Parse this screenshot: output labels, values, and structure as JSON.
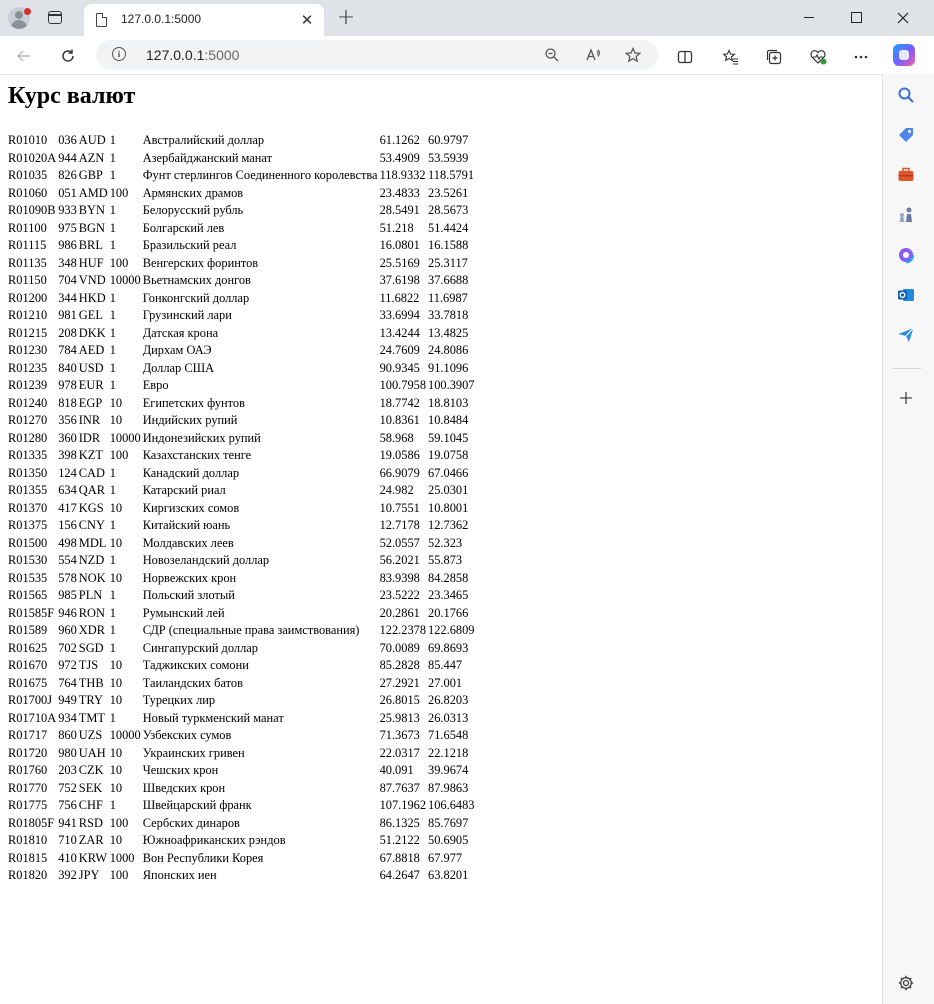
{
  "browser": {
    "tab_title": "127.0.0.1:5000",
    "url_host": "127.0.0.1",
    "url_port": ":5000",
    "new_tab_glyph": "+",
    "close_glyph": "✕"
  },
  "page": {
    "heading": "Курс валют"
  },
  "rates": [
    [
      "R01010",
      "036",
      "AUD",
      "1",
      "Австралийский доллар",
      "61.1262",
      "60.9797"
    ],
    [
      "R01020A",
      "944",
      "AZN",
      "1",
      "Азербайджанский манат",
      "53.4909",
      "53.5939"
    ],
    [
      "R01035",
      "826",
      "GBP",
      "1",
      "Фунт стерлингов Соединенного королевства",
      "118.9332",
      "118.5791"
    ],
    [
      "R01060",
      "051",
      "AMD",
      "100",
      "Армянских драмов",
      "23.4833",
      "23.5261"
    ],
    [
      "R01090B",
      "933",
      "BYN",
      "1",
      "Белорусский рубль",
      "28.5491",
      "28.5673"
    ],
    [
      "R01100",
      "975",
      "BGN",
      "1",
      "Болгарский лев",
      "51.218",
      "51.4424"
    ],
    [
      "R01115",
      "986",
      "BRL",
      "1",
      "Бразильский реал",
      "16.0801",
      "16.1588"
    ],
    [
      "R01135",
      "348",
      "HUF",
      "100",
      "Венгерских форинтов",
      "25.5169",
      "25.3117"
    ],
    [
      "R01150",
      "704",
      "VND",
      "10000",
      "Вьетнамских донгов",
      "37.6198",
      "37.6688"
    ],
    [
      "R01200",
      "344",
      "HKD",
      "1",
      "Гонконгский доллар",
      "11.6822",
      "11.6987"
    ],
    [
      "R01210",
      "981",
      "GEL",
      "1",
      "Грузинский лари",
      "33.6994",
      "33.7818"
    ],
    [
      "R01215",
      "208",
      "DKK",
      "1",
      "Датская крона",
      "13.4244",
      "13.4825"
    ],
    [
      "R01230",
      "784",
      "AED",
      "1",
      "Дирхам ОАЭ",
      "24.7609",
      "24.8086"
    ],
    [
      "R01235",
      "840",
      "USD",
      "1",
      "Доллар США",
      "90.9345",
      "91.1096"
    ],
    [
      "R01239",
      "978",
      "EUR",
      "1",
      "Евро",
      "100.7958",
      "100.3907"
    ],
    [
      "R01240",
      "818",
      "EGP",
      "10",
      "Египетских фунтов",
      "18.7742",
      "18.8103"
    ],
    [
      "R01270",
      "356",
      "INR",
      "10",
      "Индийских рупий",
      "10.8361",
      "10.8484"
    ],
    [
      "R01280",
      "360",
      "IDR",
      "10000",
      "Индонезийских рупий",
      "58.968",
      "59.1045"
    ],
    [
      "R01335",
      "398",
      "KZT",
      "100",
      "Казахстанских тенге",
      "19.0586",
      "19.0758"
    ],
    [
      "R01350",
      "124",
      "CAD",
      "1",
      "Канадский доллар",
      "66.9079",
      "67.0466"
    ],
    [
      "R01355",
      "634",
      "QAR",
      "1",
      "Катарский риал",
      "24.982",
      "25.0301"
    ],
    [
      "R01370",
      "417",
      "KGS",
      "10",
      "Киргизских сомов",
      "10.7551",
      "10.8001"
    ],
    [
      "R01375",
      "156",
      "CNY",
      "1",
      "Китайский юань",
      "12.7178",
      "12.7362"
    ],
    [
      "R01500",
      "498",
      "MDL",
      "10",
      "Молдавских леев",
      "52.0557",
      "52.323"
    ],
    [
      "R01530",
      "554",
      "NZD",
      "1",
      "Новозеландский доллар",
      "56.2021",
      "55.873"
    ],
    [
      "R01535",
      "578",
      "NOK",
      "10",
      "Норвежских крон",
      "83.9398",
      "84.2858"
    ],
    [
      "R01565",
      "985",
      "PLN",
      "1",
      "Польский злотый",
      "23.5222",
      "23.3465"
    ],
    [
      "R01585F",
      "946",
      "RON",
      "1",
      "Румынский лей",
      "20.2861",
      "20.1766"
    ],
    [
      "R01589",
      "960",
      "XDR",
      "1",
      "СДР (специальные права заимствования)",
      "122.2378",
      "122.6809"
    ],
    [
      "R01625",
      "702",
      "SGD",
      "1",
      "Сингапурский доллар",
      "70.0089",
      "69.8693"
    ],
    [
      "R01670",
      "972",
      "TJS",
      "10",
      "Таджикских сомони",
      "85.2828",
      "85.447"
    ],
    [
      "R01675",
      "764",
      "THB",
      "10",
      "Таиландских батов",
      "27.2921",
      "27.001"
    ],
    [
      "R01700J",
      "949",
      "TRY",
      "10",
      "Турецких лир",
      "26.8015",
      "26.8203"
    ],
    [
      "R01710A",
      "934",
      "TMT",
      "1",
      "Новый туркменский манат",
      "25.9813",
      "26.0313"
    ],
    [
      "R01717",
      "860",
      "UZS",
      "10000",
      "Узбекских сумов",
      "71.3673",
      "71.6548"
    ],
    [
      "R01720",
      "980",
      "UAH",
      "10",
      "Украинских гривен",
      "22.0317",
      "22.1218"
    ],
    [
      "R01760",
      "203",
      "CZK",
      "10",
      "Чешских крон",
      "40.091",
      "39.9674"
    ],
    [
      "R01770",
      "752",
      "SEK",
      "10",
      "Шведских крон",
      "87.7637",
      "87.9863"
    ],
    [
      "R01775",
      "756",
      "CHF",
      "1",
      "Швейцарский франк",
      "107.1962",
      "106.6483"
    ],
    [
      "R01805F",
      "941",
      "RSD",
      "100",
      "Сербских динаров",
      "86.1325",
      "85.7697"
    ],
    [
      "R01810",
      "710",
      "ZAR",
      "10",
      "Южноафриканских рэндов",
      "51.2122",
      "50.6905"
    ],
    [
      "R01815",
      "410",
      "KRW",
      "1000",
      "Вон Республики Корея",
      "67.8818",
      "67.977"
    ],
    [
      "R01820",
      "392",
      "JPY",
      "100",
      "Японских иен",
      "64.2647",
      "63.8201"
    ]
  ],
  "colors": {
    "tabstrip": "#dfe3e8",
    "urlbar": "#f1f3f4",
    "sidebar": "#f7f7f7",
    "profile_badge": "#d32f2f"
  },
  "icons": {
    "sidebar": [
      "search-icon",
      "tag-icon",
      "toolbox-icon",
      "chess-icon",
      "office-icon",
      "outlook-icon",
      "send-icon",
      "add-icon",
      "settings-icon"
    ]
  }
}
